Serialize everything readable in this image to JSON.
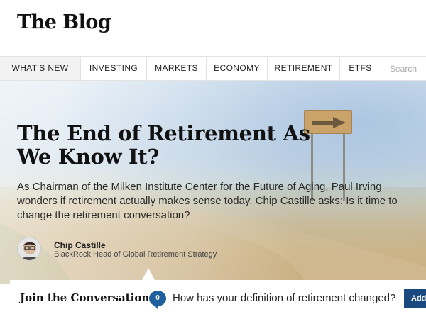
{
  "site": {
    "title": "The Blog"
  },
  "nav": {
    "items": [
      {
        "label": "WHAT'S NEW",
        "active": true
      },
      {
        "label": "INVESTING",
        "active": false
      },
      {
        "label": "MARKETS",
        "active": false
      },
      {
        "label": "ECONOMY",
        "active": false
      },
      {
        "label": "RETIREMENT",
        "active": false
      },
      {
        "label": "ETFS",
        "active": false
      }
    ],
    "search_placeholder": "Search"
  },
  "article": {
    "title": "The End of Retirement As We Know It?",
    "deck": "As Chairman of the Milken Institute Center for the Future of Aging, Paul Irving wonders if retirement actually makes sense today. Chip Castille asks: Is it time to change the retirement conversation?",
    "author": {
      "name": "Chip Castille",
      "role": "BlackRock Head of Global Retirement Strategy"
    }
  },
  "conversation": {
    "label": "Join the Conversation",
    "count": "0",
    "question": "How has your definition of retirement changed?",
    "button_label": "Add"
  },
  "colors": {
    "accent_blue": "#1f5f9d",
    "button_blue": "#1a4a80"
  }
}
